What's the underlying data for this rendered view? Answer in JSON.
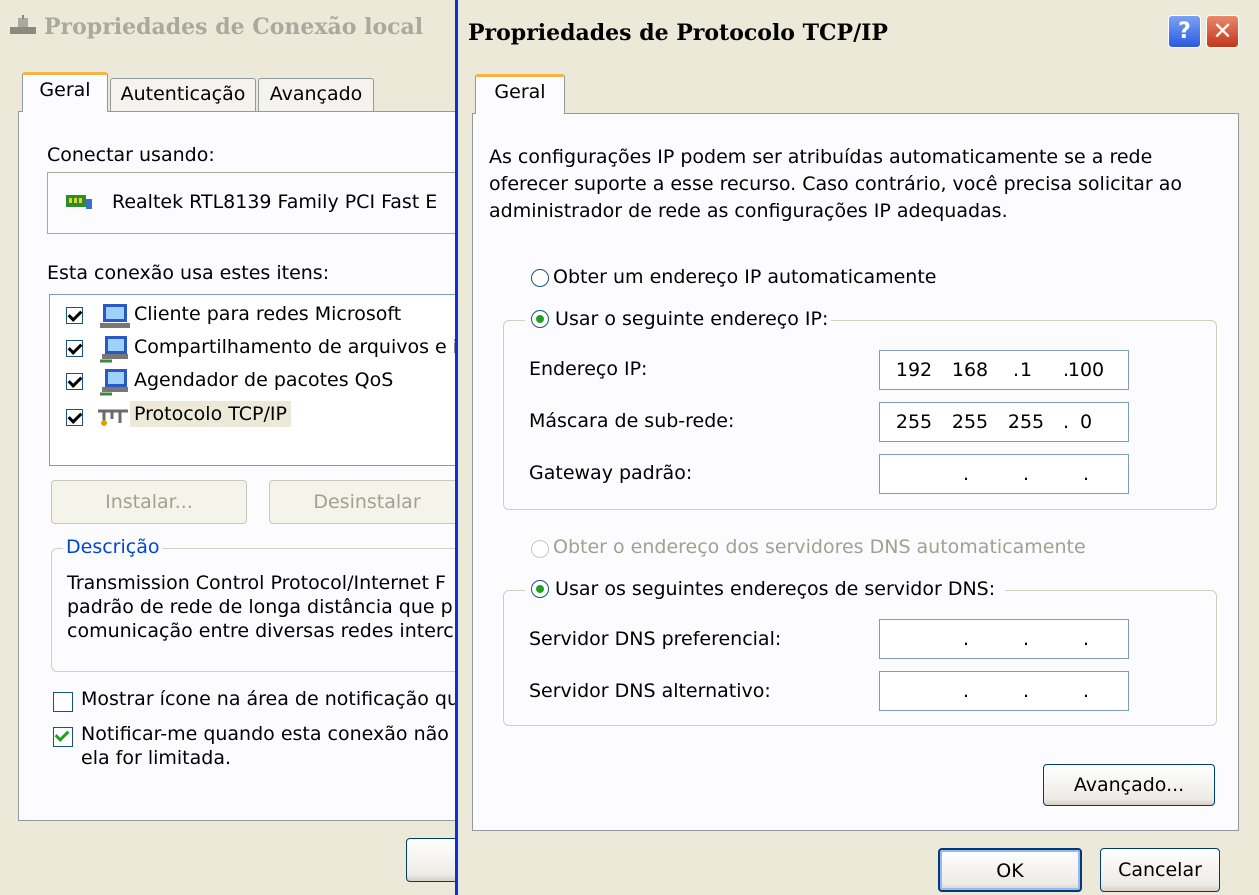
{
  "back_dialog": {
    "title": "Propriedades de Conexão local",
    "tabs": [
      "Geral",
      "Autenticação",
      "Avançado"
    ],
    "connect_using_label": "Conectar usando:",
    "adapter_name": "Realtek RTL8139 Family PCI Fast E",
    "items_label": "Esta conexão usa estes itens:",
    "items": [
      {
        "label": "Cliente para redes Microsoft",
        "checked": true,
        "icon": "network-client-icon"
      },
      {
        "label": "Compartilhamento de arquivos e ir",
        "checked": true,
        "icon": "file-sharing-icon"
      },
      {
        "label": "Agendador de pacotes QoS",
        "checked": true,
        "icon": "qos-scheduler-icon"
      },
      {
        "label": "Protocolo TCP/IP",
        "checked": true,
        "icon": "protocol-icon"
      }
    ],
    "install_button": "Instalar...",
    "uninstall_button": "Desinstalar",
    "description_legend": "Descrição",
    "description_lines": [
      "Transmission Control Protocol/Internet F",
      "padrão de rede de longa distância que p",
      "comunicação entre diversas redes interc"
    ],
    "show_icon_label": "Mostrar ícone na área de notificação qu",
    "show_icon_checked": false,
    "notify_label_line1": "Notificar-me quando esta conexão não",
    "notify_label_line2": "ela for limitada.",
    "notify_checked": true
  },
  "front_dialog": {
    "title": "Propriedades de Protocolo TCP/IP",
    "help_glyph": "?",
    "close_glyph": "✕",
    "tab": "Geral",
    "intro_lines": [
      "As configurações IP podem ser atribuídas automaticamente se a rede",
      "oferecer suporte a esse recurso. Caso contrário, você precisa solicitar ao",
      "administrador de rede as configurações IP adequadas."
    ],
    "radio_auto_ip": "Obter um endereço IP automaticamente",
    "radio_manual_ip": "Usar o seguinte endereço IP:",
    "ip_selected": "manual",
    "ip_address_label": "Endereço IP:",
    "ip_address": [
      "192",
      "168",
      "1",
      "100"
    ],
    "subnet_label": "Máscara de sub-rede:",
    "subnet": [
      "255",
      "255",
      "255",
      "0"
    ],
    "gateway_label": "Gateway padrão:",
    "gateway": [
      "",
      "",
      "",
      ""
    ],
    "radio_auto_dns": "Obter o endereço dos servidores DNS automaticamente",
    "radio_manual_dns": "Usar os seguintes endereços de servidor DNS:",
    "dns_selected": "manual",
    "preferred_dns_label": "Servidor DNS preferencial:",
    "preferred_dns": [
      "",
      "",
      "",
      ""
    ],
    "alternate_dns_label": "Servidor DNS alternativo:",
    "alternate_dns": [
      "",
      "",
      "",
      ""
    ],
    "advanced_button": "Avançado...",
    "ok_button": "OK",
    "cancel_button": "Cancelar"
  }
}
